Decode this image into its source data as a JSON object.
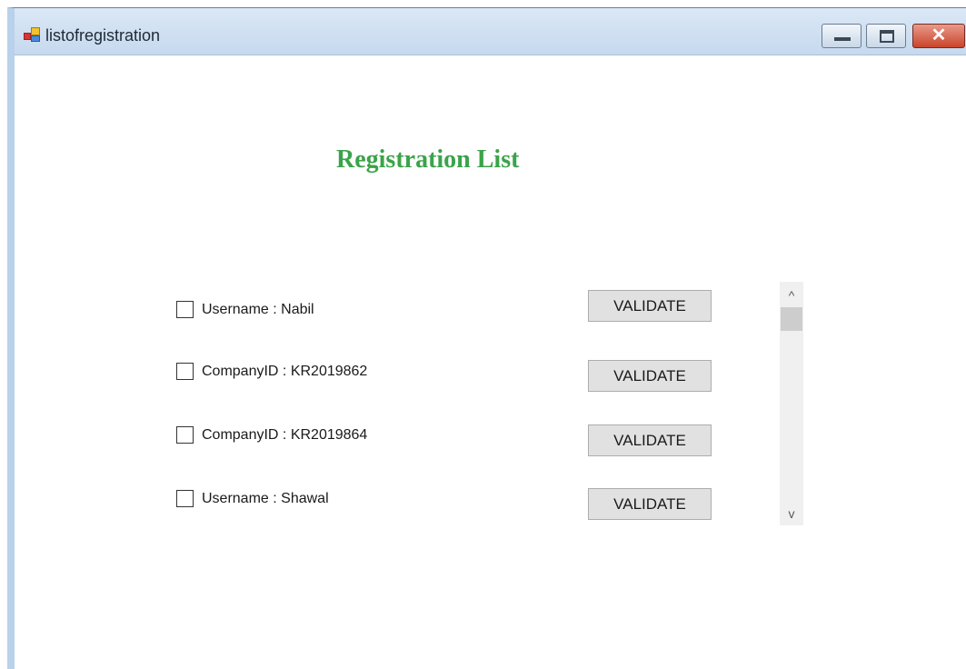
{
  "window": {
    "title": "listofregistration",
    "close_glyph": "✕"
  },
  "main": {
    "heading": "Registration List"
  },
  "rows": [
    {
      "label": "Username : Nabil",
      "button": "VALIDATE",
      "checked": false
    },
    {
      "label": "CompanyID : KR2019862",
      "button": "VALIDATE",
      "checked": false
    },
    {
      "label": "CompanyID : KR2019864",
      "button": "VALIDATE",
      "checked": false
    },
    {
      "label": "Username : Shawal",
      "button": "VALIDATE",
      "checked": false
    }
  ],
  "scrollbar": {
    "up_glyph": "^",
    "down_glyph": "v"
  },
  "colors": {
    "heading": "#3ba34a",
    "button_bg": "#e1e1e1",
    "titlebar": "#c6d9ee"
  }
}
